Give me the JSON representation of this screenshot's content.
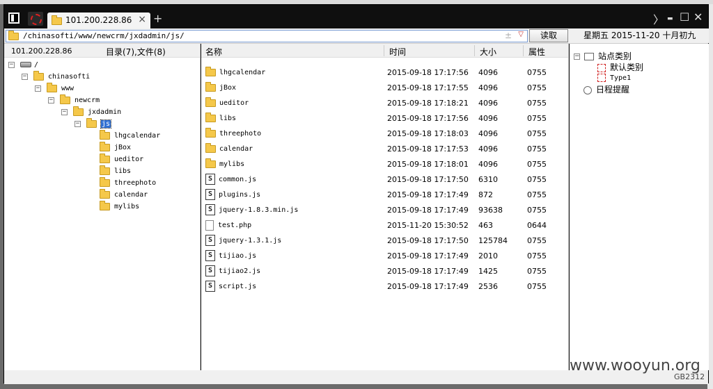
{
  "window": {
    "tab_title": "101.200.228.86",
    "tab_close": "×",
    "tab_add": "+",
    "controls": {
      "nav": "〉",
      "minimize": "▬",
      "maximize": "☐",
      "close": "✕"
    }
  },
  "pathbar": {
    "path": "/chinasofti/www/newcrm/jxdadmin/js/",
    "plus": "±",
    "dropdown": "▽",
    "read_button": "读取"
  },
  "datebox": {
    "text": "星期五  2015-11-20  十月初九"
  },
  "tree": {
    "host": "101.200.228.86",
    "counts": "目录(7),文件(8)",
    "root": "/",
    "nodes": [
      "chinasofti",
      "www",
      "newcrm",
      "jxdadmin",
      "js"
    ],
    "children": [
      "lhgcalendar",
      "jBox",
      "ueditor",
      "libs",
      "threephoto",
      "calendar",
      "mylibs"
    ]
  },
  "files": {
    "headers": {
      "name": "名称",
      "time": "时间",
      "size": "大小",
      "attr": "属性"
    },
    "rows": [
      {
        "name": "lhgcalendar",
        "time": "2015-09-18  17:17:56",
        "size": "4096",
        "attr": "0755",
        "type": "folder"
      },
      {
        "name": "jBox",
        "time": "2015-09-18  17:17:55",
        "size": "4096",
        "attr": "0755",
        "type": "folder"
      },
      {
        "name": "ueditor",
        "time": "2015-09-18  17:18:21",
        "size": "4096",
        "attr": "0755",
        "type": "folder"
      },
      {
        "name": "libs",
        "time": "2015-09-18  17:17:56",
        "size": "4096",
        "attr": "0755",
        "type": "folder"
      },
      {
        "name": "threephoto",
        "time": "2015-09-18  17:18:03",
        "size": "4096",
        "attr": "0755",
        "type": "folder"
      },
      {
        "name": "calendar",
        "time": "2015-09-18  17:17:53",
        "size": "4096",
        "attr": "0755",
        "type": "folder"
      },
      {
        "name": "mylibs",
        "time": "2015-09-18  17:18:01",
        "size": "4096",
        "attr": "0755",
        "type": "folder"
      },
      {
        "name": "common.js",
        "time": "2015-09-18  17:17:50",
        "size": "6310",
        "attr": "0755",
        "type": "js"
      },
      {
        "name": "plugins.js",
        "time": "2015-09-18  17:17:49",
        "size": "872",
        "attr": "0755",
        "type": "js"
      },
      {
        "name": "jquery-1.8.3.min.js",
        "time": "2015-09-18  17:17:49",
        "size": "93638",
        "attr": "0755",
        "type": "js"
      },
      {
        "name": "test.php",
        "time": "2015-11-20  15:30:52",
        "size": "463",
        "attr": "0644",
        "type": "php"
      },
      {
        "name": "jquery-1.3.1.js",
        "time": "2015-09-18  17:17:50",
        "size": "125784",
        "attr": "0755",
        "type": "js"
      },
      {
        "name": "tijiao.js",
        "time": "2015-09-18  17:17:49",
        "size": "2010",
        "attr": "0755",
        "type": "js"
      },
      {
        "name": "tijiao2.js",
        "time": "2015-09-18  17:17:49",
        "size": "1425",
        "attr": "0755",
        "type": "js"
      },
      {
        "name": "script.js",
        "time": "2015-09-18  17:17:49",
        "size": "2536",
        "attr": "0755",
        "type": "js"
      }
    ]
  },
  "sites": {
    "root": "站点类别",
    "items": [
      "默认类别",
      "Type1"
    ],
    "reminder": "日程提醒"
  },
  "watermark": "www.wooyun.org",
  "encoding": "GB2312"
}
